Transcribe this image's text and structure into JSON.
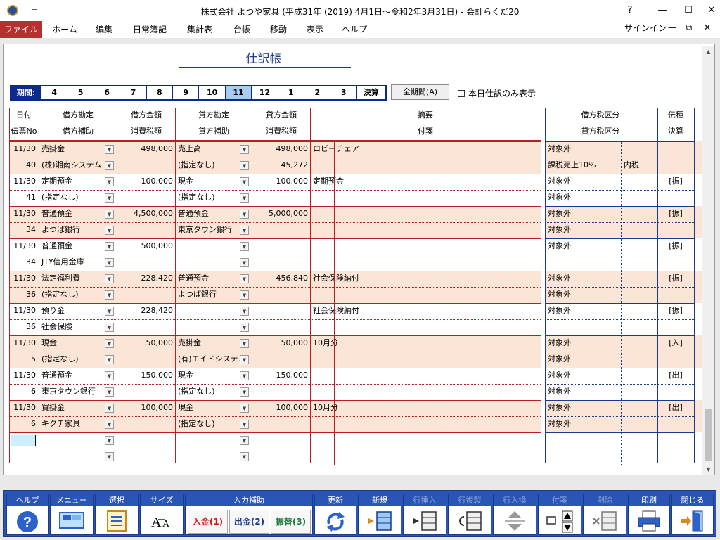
{
  "window": {
    "title": "株式会社 よつや家具 (平成31年 (2019) 4月1日～令和2年3月31日) - 会計らくだ20",
    "help": "?",
    "minimize": "—",
    "maximize": "☐",
    "close": "✕",
    "quick_access": "="
  },
  "menu": {
    "items": [
      "ファイル",
      "ホーム",
      "編集",
      "日常簿記",
      "集計表",
      "台帳",
      "移動",
      "表示",
      "ヘルプ"
    ],
    "signin": "サインイン",
    "doc_min": "—",
    "doc_restore": "⧉",
    "doc_close": "✕"
  },
  "journal": {
    "title": "仕訳帳",
    "period_label": "期間:",
    "periods": [
      "4",
      "5",
      "6",
      "7",
      "8",
      "9",
      "10",
      "11",
      "12",
      "1",
      "2",
      "3",
      "決算"
    ],
    "selected_period": "11",
    "all_period_button": "全期間(A)",
    "today_only_label": "本日仕訳のみ表示",
    "headers": {
      "date": "日付",
      "slip": "伝票No",
      "debit_account": "借方勘定",
      "debit_sub": "借方補助",
      "debit_amount": "借方金額",
      "debit_tax": "消費税額",
      "credit_account": "貸方勘定",
      "credit_sub": "貸方補助",
      "credit_amount": "貸方金額",
      "credit_tax": "消費税額",
      "memo": "摘要",
      "tag": "付箋",
      "debit_tax_cat": "借方税区分",
      "credit_tax_cat": "貸方税区分",
      "slip_type": "伝種",
      "settle": "決算"
    },
    "rows": [
      {
        "date": "11/30",
        "no": "40",
        "dacc": "売掛金",
        "dsub": "(株)湘南システム",
        "damt": "498,000",
        "dtax": "",
        "cacc": "売上高",
        "csub": "(指定なし)",
        "camt": "498,000",
        "ctax": "45,272",
        "memo": "ロビーチェア",
        "dtc": "対象外",
        "ctc": "課税売上10%",
        "ctc2": "内税",
        "type": ""
      },
      {
        "date": "11/30",
        "no": "41",
        "dacc": "定期預金",
        "dsub": "(指定なし)",
        "damt": "100,000",
        "dtax": "",
        "cacc": "現金",
        "csub": "(指定なし)",
        "camt": "100,000",
        "ctax": "",
        "memo": "定期預金",
        "dtc": "対象外",
        "ctc": "対象外",
        "ctc2": "",
        "type": "[振]"
      },
      {
        "date": "11/30",
        "no": "34",
        "dacc": "普通預金",
        "dsub": "よつば銀行",
        "damt": "4,500,000",
        "dtax": "",
        "cacc": "普通預金",
        "csub": "東京タウン銀行",
        "camt": "5,000,000",
        "ctax": "",
        "memo": "",
        "dtc": "対象外",
        "ctc": "対象外",
        "ctc2": "",
        "type": "[振]"
      },
      {
        "date": "11/30",
        "no": "34",
        "dacc": "普通預金",
        "dsub": "JTY信用金庫",
        "damt": "500,000",
        "dtax": "",
        "cacc": "",
        "csub": "",
        "camt": "",
        "ctax": "",
        "memo": "",
        "dtc": "対象外",
        "ctc": "",
        "ctc2": "",
        "type": "[振]"
      },
      {
        "date": "11/30",
        "no": "36",
        "dacc": "法定福利費",
        "dsub": "(指定なし)",
        "damt": "228,420",
        "dtax": "",
        "cacc": "普通預金",
        "csub": "よつば銀行",
        "camt": "456,840",
        "ctax": "",
        "memo": "社会保険納付",
        "dtc": "対象外",
        "ctc": "対象外",
        "ctc2": "",
        "type": "[振]"
      },
      {
        "date": "11/30",
        "no": "36",
        "dacc": "預り金",
        "dsub": "社会保険",
        "damt": "228,420",
        "dtax": "",
        "cacc": "",
        "csub": "",
        "camt": "",
        "ctax": "",
        "memo": "社会保険納付",
        "dtc": "対象外",
        "ctc": "",
        "ctc2": "",
        "type": "[振]"
      },
      {
        "date": "11/30",
        "no": "5",
        "dacc": "現金",
        "dsub": "(指定なし)",
        "damt": "50,000",
        "dtax": "",
        "cacc": "売掛金",
        "csub": "(有)エイドシステム",
        "camt": "50,000",
        "ctax": "",
        "memo": "10月分",
        "dtc": "対象外",
        "ctc": "対象外",
        "ctc2": "",
        "type": "[入]"
      },
      {
        "date": "11/30",
        "no": "6",
        "dacc": "普通預金",
        "dsub": "東京タウン銀行",
        "damt": "150,000",
        "dtax": "",
        "cacc": "現金",
        "csub": "(指定なし)",
        "camt": "150,000",
        "ctax": "",
        "memo": "",
        "dtc": "対象外",
        "ctc": "対象外",
        "ctc2": "",
        "type": "[出]"
      },
      {
        "date": "11/30",
        "no": "6",
        "dacc": "買掛金",
        "dsub": "キクチ家具",
        "damt": "100,000",
        "dtax": "",
        "cacc": "現金",
        "csub": "(指定なし)",
        "camt": "100,000",
        "ctax": "",
        "memo": "10月分",
        "dtc": "対象外",
        "ctc": "対象外",
        "ctc2": "",
        "type": "[出]"
      }
    ]
  },
  "toolbar": {
    "help": "ヘルプ",
    "menu": "メニュー",
    "select": "選択",
    "size": "サイズ",
    "input_assist": "入力補助",
    "deposit": "入金(1)",
    "withdraw": "出金(2)",
    "transfer": "振替(3)",
    "refresh": "更新",
    "new": "新規",
    "insert_row": "行挿入",
    "copy_row": "行複製",
    "swap_row": "行入換",
    "tag": "付箋",
    "delete": "削除",
    "print": "印刷",
    "close": "閉じる",
    "colors": {
      "deposit": "#d01818",
      "withdraw": "#1a3a8c",
      "transfer": "#1a7a3a"
    }
  }
}
